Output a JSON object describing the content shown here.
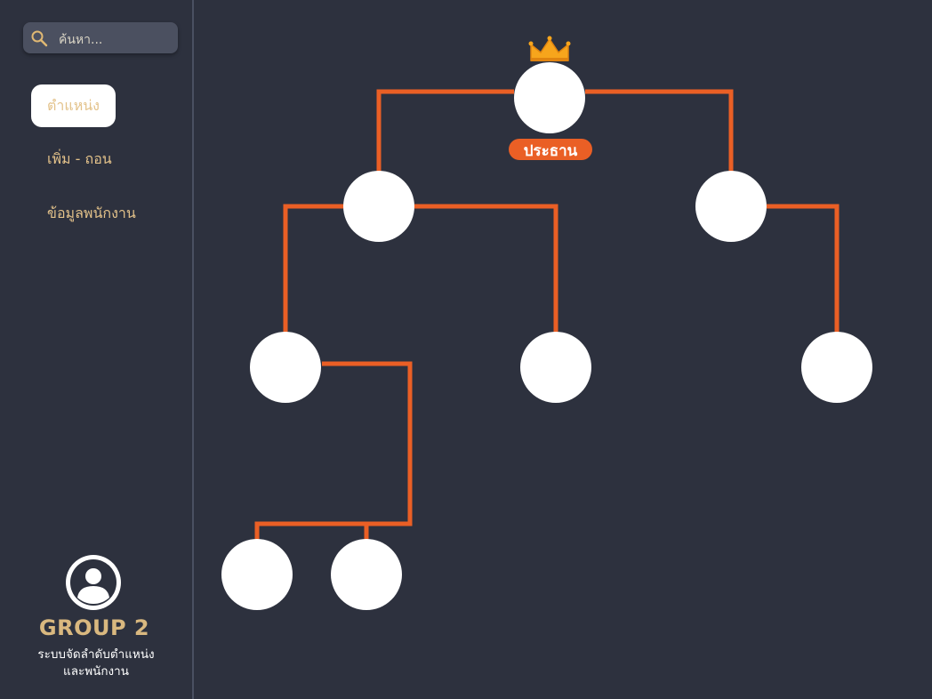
{
  "sidebar": {
    "search": {
      "placeholder": "ค้นหา..."
    },
    "items": [
      {
        "label": "ตำแหน่ง",
        "active": true
      },
      {
        "label": "เพิ่ม - ถอน",
        "active": false
      },
      {
        "label": "ข้อมูลพนักงาน",
        "active": false
      }
    ],
    "group": {
      "name": "GROUP 2",
      "subtitle_line1": "ระบบจัดลำดับตำแหน่ง",
      "subtitle_line2": "และพนักงาน"
    }
  },
  "org_chart": {
    "root_label": "ประธาน",
    "root_icon": "crown-icon",
    "line_color": "#ea5f25",
    "node_color": "#ffffff"
  }
}
